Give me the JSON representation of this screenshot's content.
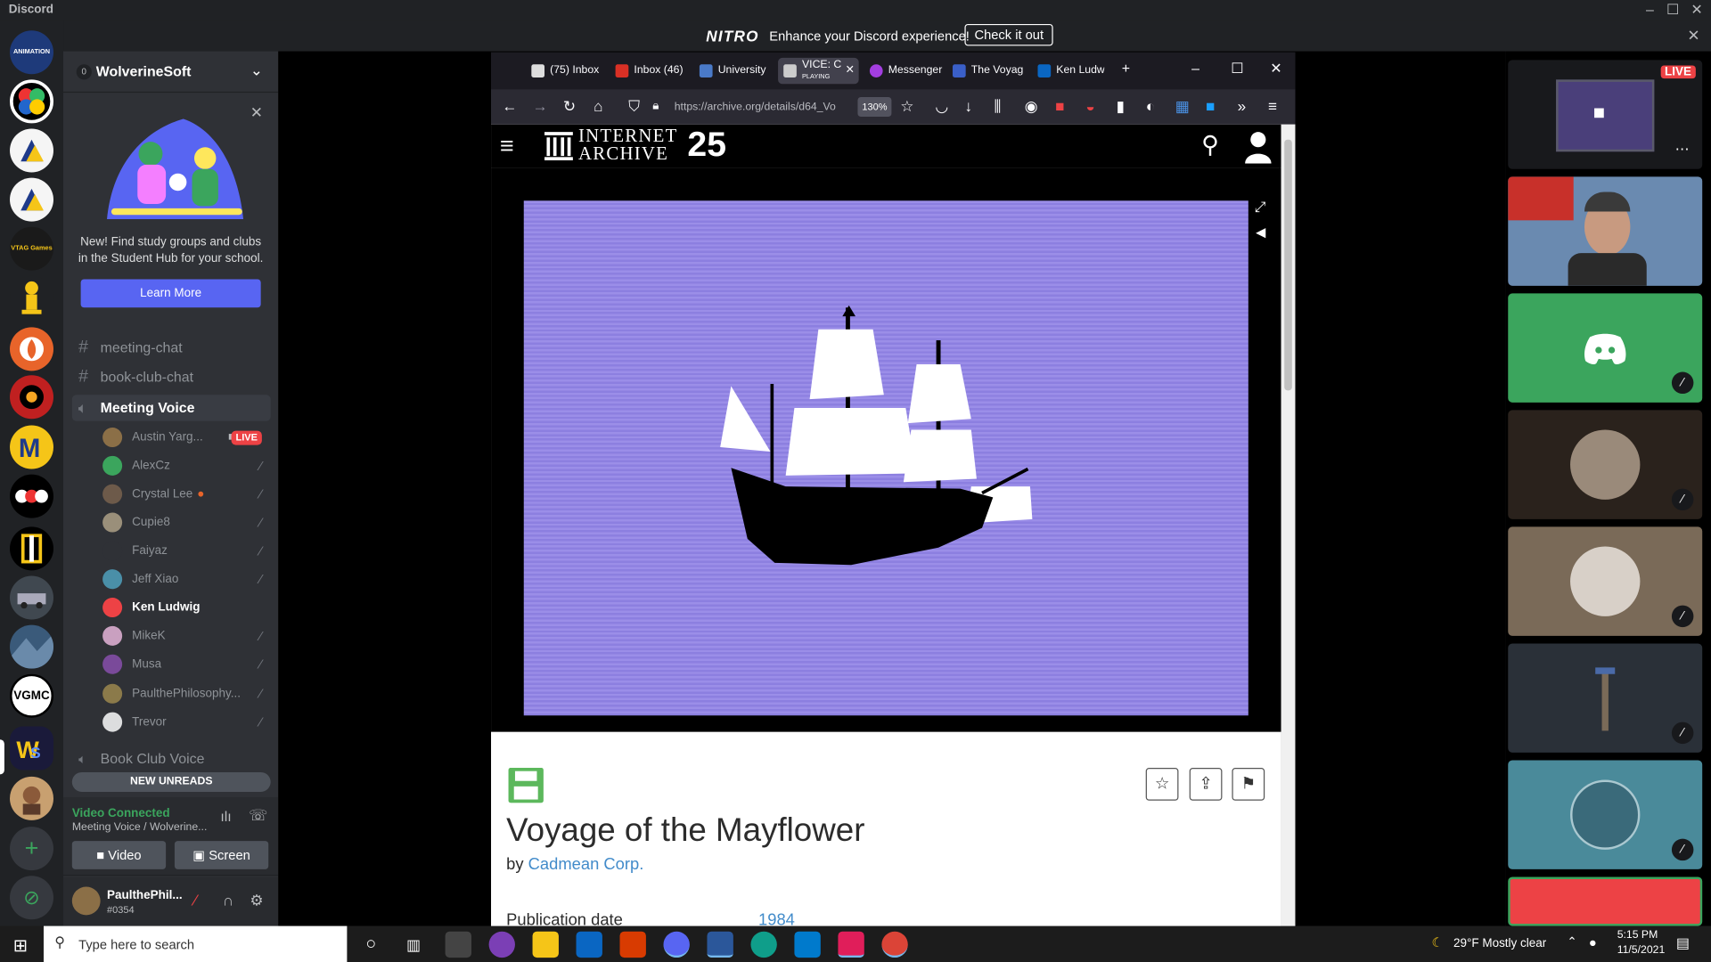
{
  "window": {
    "title": "Discord"
  },
  "nitro_banner": {
    "logo": "NITRO",
    "text": "Enhance your Discord experience!",
    "button": "Check it out"
  },
  "server": {
    "name": "WolverineSoft",
    "badge": "0"
  },
  "promo": {
    "text": "New! Find study groups and clubs in the Student Hub for your school.",
    "button": "Learn More"
  },
  "channels": [
    {
      "name": "meeting-chat",
      "type": "text"
    },
    {
      "name": "book-club-chat",
      "type": "text"
    },
    {
      "name": "Meeting Voice",
      "type": "voice",
      "active": true
    }
  ],
  "voice_users": [
    {
      "name": "Austin Yarg...",
      "live": "LIVE",
      "color": "#8b6f47"
    },
    {
      "name": "AlexCz",
      "color": "#3ba55d"
    },
    {
      "name": "Crystal Lee",
      "color": "#6d5a4a"
    },
    {
      "name": "Cupie8",
      "color": "#9a8f7a"
    },
    {
      "name": "Faiyaz",
      "color": "#2f3136"
    },
    {
      "name": "Jeff Xiao",
      "color": "#4a8fa8"
    },
    {
      "name": "Ken Ludwig",
      "color": "#ed4245",
      "speaking": true
    },
    {
      "name": "MikeK",
      "color": "#c9a0c0"
    },
    {
      "name": "Musa",
      "color": "#7a4a9a"
    },
    {
      "name": "PaulthePhilosophy...",
      "color": "#8b7a4a"
    },
    {
      "name": "Trevor",
      "color": "#dcddde"
    }
  ],
  "book_club_voice": "Book Club Voice",
  "new_unreads": "NEW UNREADS",
  "voice_connection": {
    "status": "Video Connected",
    "sub": "Meeting Voice / Wolverine...",
    "video_label": "Video",
    "screen_label": "Screen"
  },
  "user": {
    "name": "PaulthePhil...",
    "tag": "#0354"
  },
  "guild_labels": [
    "ANIMATION",
    "",
    "",
    "",
    "VTAG Games",
    "",
    "",
    "",
    "",
    "",
    "",
    "",
    "",
    "VGMC",
    "",
    ""
  ],
  "browser": {
    "tabs": [
      "(75) Inbox",
      "Inbox (46)",
      "University",
      "VICE: C",
      "Messenger",
      "The Voyag",
      "Ken Ludwi"
    ],
    "active_tab_sub": "PLAYING",
    "url": "https://archive.org/details/d64_Vo",
    "zoom": "130%"
  },
  "archive": {
    "brand_line1": "INTERNET",
    "brand_line2": "ARCHIVE",
    "anniversary": "25",
    "title": "Voyage of the Mayflower",
    "by": "by",
    "author": "Cadmean Corp.",
    "pub_label": "Publication date",
    "pub_value": "1984"
  },
  "tiles": {
    "live": "LIVE"
  },
  "taskbar": {
    "search_placeholder": "Type here to search",
    "weather": "29°F  Mostly clear",
    "time": "5:15 PM",
    "date": "11/5/2021"
  },
  "colors": {
    "blurple": "#5865f2",
    "green": "#3ba55d",
    "red": "#ed4245",
    "screen": "#9b8ee8"
  }
}
